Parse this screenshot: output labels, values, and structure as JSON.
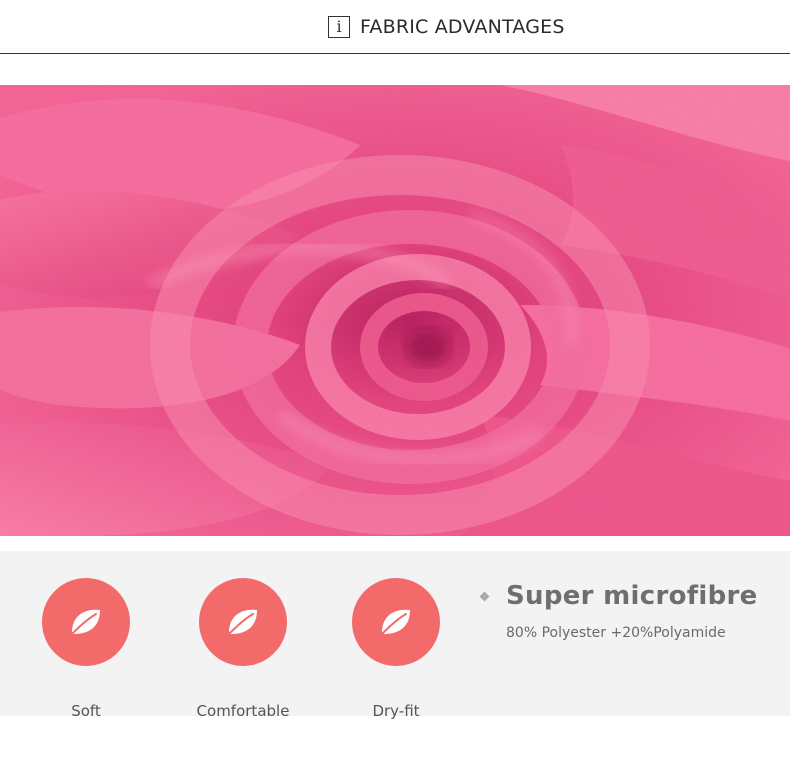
{
  "header": {
    "info_icon": "i",
    "title": "FABRIC ADVANTAGES"
  },
  "image": {
    "subject": "pink-microfiber-fabric-swirl",
    "color": "#f0457e"
  },
  "features": {
    "items": [
      {
        "label": "Soft",
        "icon": "feather-icon"
      },
      {
        "label": "Comfortable",
        "icon": "feather-icon"
      },
      {
        "label": "Dry-fit",
        "icon": "feather-icon"
      }
    ],
    "circle_color": "#f26a6a"
  },
  "spec": {
    "title": "Super microfibre",
    "composition": "80% Polyester +20%Polyamide"
  }
}
